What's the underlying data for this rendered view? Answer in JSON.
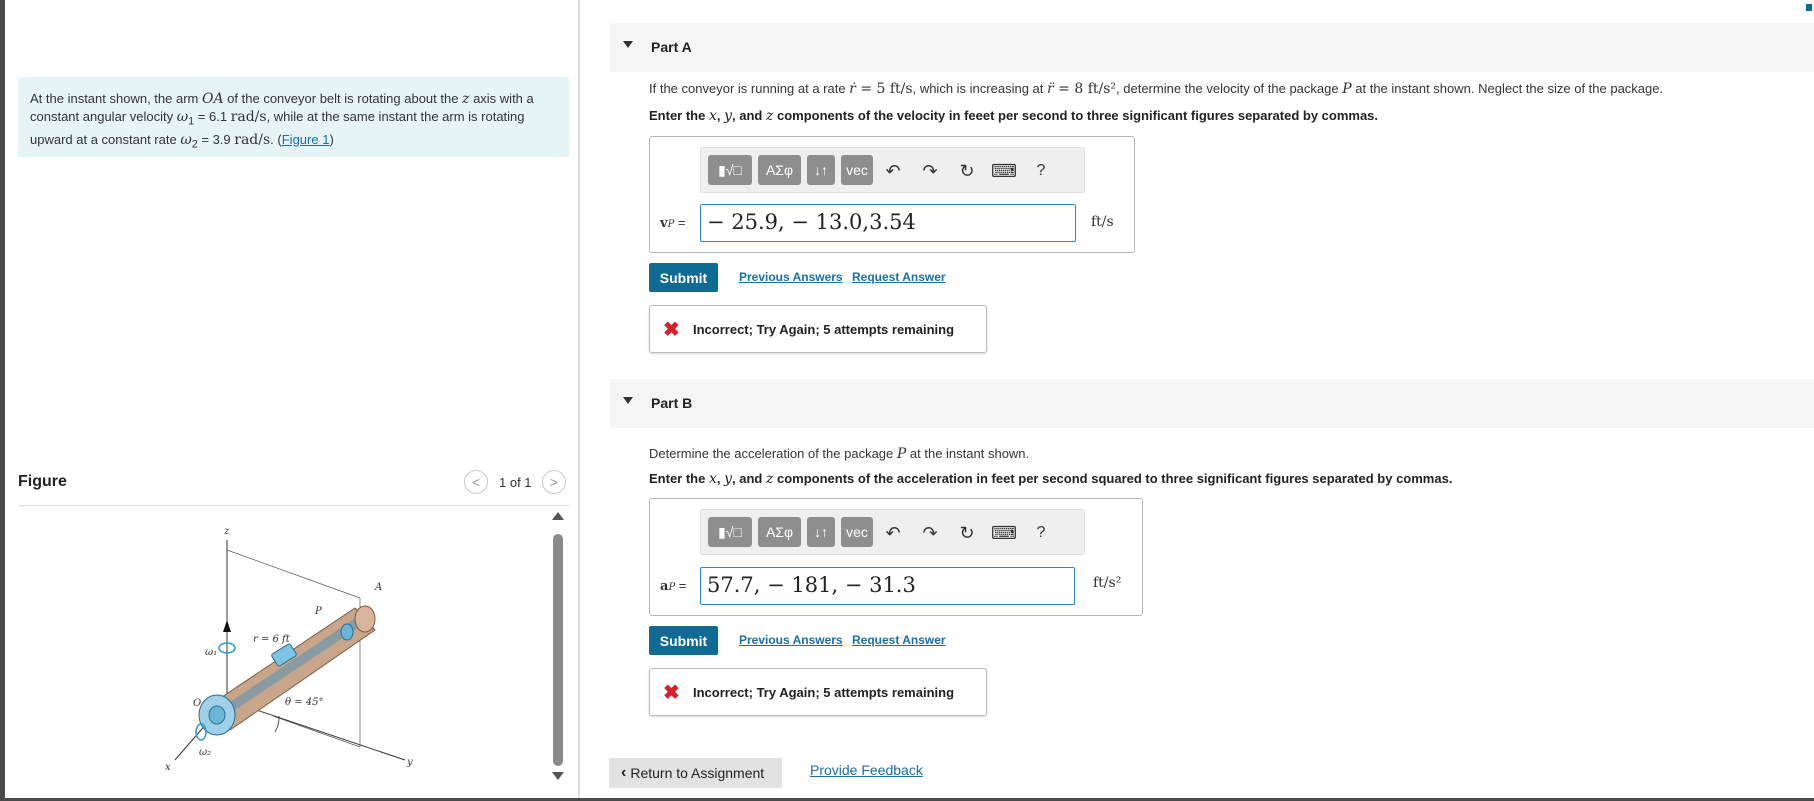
{
  "intro": {
    "t1": "At the instant shown, the arm ",
    "arm": "OA",
    "t2": " of the conveyor belt is rotating about the ",
    "axis": "z",
    "t3": " axis with a constant angular velocity ",
    "w1": "ω",
    "w1sub": "1",
    "t4": " = 6.1 ",
    "unit1": "rad/s",
    "t5": ", while at the same instant the arm is rotating upward at a constant rate ",
    "w2": "ω",
    "w2sub": "2",
    "t6": " = 3.9 ",
    "unit2": "rad/s",
    "t7": ". (",
    "figure_link": "Figure 1",
    "t8": ")"
  },
  "figure": {
    "title": "Figure",
    "count": "1 of 1",
    "prev": "<",
    "next": ">",
    "labels": {
      "z": "z",
      "a": "A",
      "p": "P",
      "r": "r = 6 ft",
      "w1": "ω₁",
      "o": "O",
      "theta": "θ = 45°",
      "w2": "ω₂",
      "x": "x",
      "y": "y"
    }
  },
  "toolbar": {
    "templates": "▮√□",
    "greek": "ΑΣφ",
    "updown": "↓↑",
    "vec": "vec",
    "undo": "↶",
    "redo": "↷",
    "reset": "↻",
    "keyboard": "⌨",
    "help": "?"
  },
  "part_a": {
    "title": "Part A",
    "q1": "If the conveyor is running at a rate ",
    "rdot": "ṙ",
    "q2": " = 5 ",
    "u1": "ft/s",
    "q3": ", which is increasing at ",
    "rddot": "r̈",
    "q4": " = 8 ",
    "u2": "ft/s²",
    "q5": ", determine the velocity of the package ",
    "p": "P",
    "q6": " at the instant shown. Neglect the size of the package.",
    "i1": "Enter the ",
    "ix": "x",
    "i2": ", ",
    "iy": "y",
    "i3": ", and ",
    "iz": "z",
    "i4": " components of the velocity in feeet per second to three significant figures separated by commas.",
    "label_v": "v",
    "label_sub": "P",
    "label_eq": " =",
    "answer": "− 25.9, − 13.0,3.54",
    "unit": "ft/s",
    "submit": "Submit",
    "prev_answers": "Previous Answers",
    "request_answer": "Request Answer",
    "feedback_icon": "✖",
    "feedback": "Incorrect; Try Again; 5 attempts remaining"
  },
  "part_b": {
    "title": "Part B",
    "q1": "Determine the acceleration of the package ",
    "p": "P",
    "q2": " at the instant shown.",
    "i1": "Enter the ",
    "ix": "x",
    "i2": ", ",
    "iy": "y",
    "i3": ", and ",
    "iz": "z",
    "i4": " components of the acceleration in feet per second squared to three significant figures separated by commas.",
    "label_v": "a",
    "label_sub": "P",
    "label_eq": " =",
    "answer": "57.7, − 181, − 31.3",
    "unit": "ft/s²",
    "submit": "Submit",
    "prev_answers": "Previous Answers",
    "request_answer": "Request Answer",
    "feedback_icon": "✖",
    "feedback": "Incorrect; Try Again; 5 attempts remaining"
  },
  "footer": {
    "return_icon": "‹",
    "return_label": "Return to Assignment",
    "provide_feedback": "Provide Feedback"
  },
  "colors": {
    "accent": "#0f6b94",
    "link": "#1a6fa3",
    "error": "#d61f26",
    "intro_bg": "#e6f4f6"
  }
}
